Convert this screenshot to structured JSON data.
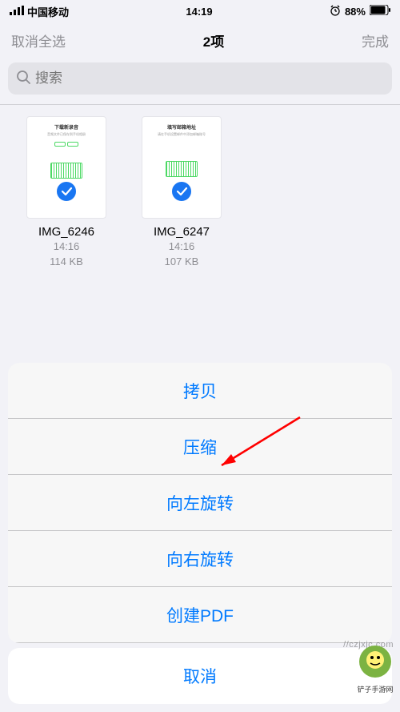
{
  "status": {
    "carrier": "中国移动",
    "time": "14:19",
    "battery": "88%"
  },
  "nav": {
    "deselect": "取消全选",
    "title": "2项",
    "done": "完成"
  },
  "search": {
    "placeholder": "搜索"
  },
  "files": [
    {
      "name": "IMG_6246",
      "time": "14:16",
      "size": "114 KB"
    },
    {
      "name": "IMG_6247",
      "time": "14:16",
      "size": "107 KB"
    }
  ],
  "sheet": {
    "actions": [
      {
        "label": "拷贝"
      },
      {
        "label": "压缩"
      },
      {
        "label": "向左旋转"
      },
      {
        "label": "向右旋转"
      },
      {
        "label": "创建PDF"
      }
    ],
    "cancel": "取消"
  },
  "watermark": "//czjxjc.com",
  "watermark_label": "铲子手游网"
}
